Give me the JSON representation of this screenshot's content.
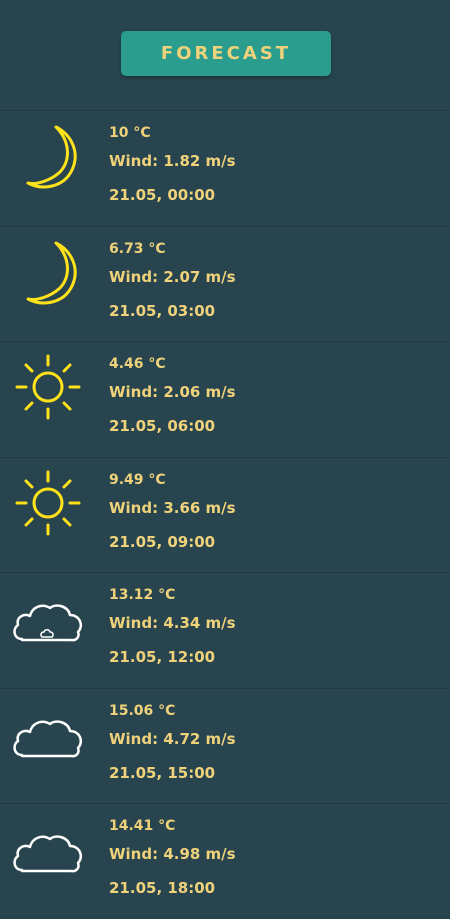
{
  "header": {
    "button_label": "FORECAST"
  },
  "colors": {
    "background": "#27444f",
    "button": "#2a9d8f",
    "text": "#efd27a",
    "moon": "#ffe21a",
    "sun": "#ffe21a",
    "cloud": "#ffffff"
  },
  "forecast": [
    {
      "icon": "moon-icon",
      "temp": "10 °C",
      "wind": "Wind: 1.82 m/s",
      "datetime": "21.05, 00:00"
    },
    {
      "icon": "moon-icon",
      "temp": "6.73 °C",
      "wind": "Wind: 2.07 m/s",
      "datetime": "21.05, 03:00"
    },
    {
      "icon": "sun-icon",
      "temp": "4.46 °C",
      "wind": "Wind: 2.06 m/s",
      "datetime": "21.05, 06:00"
    },
    {
      "icon": "sun-icon",
      "temp": "9.49 °C",
      "wind": "Wind: 3.66 m/s",
      "datetime": "21.05, 09:00"
    },
    {
      "icon": "cloud-rain-icon",
      "temp": "13.12 °C",
      "wind": "Wind: 4.34 m/s",
      "datetime": "21.05, 12:00"
    },
    {
      "icon": "cloud-icon",
      "temp": "15.06 °C",
      "wind": "Wind: 4.72 m/s",
      "datetime": "21.05, 15:00"
    },
    {
      "icon": "cloud-icon",
      "temp": "14.41 °C",
      "wind": "Wind: 4.98 m/s",
      "datetime": "21.05, 18:00"
    }
  ]
}
